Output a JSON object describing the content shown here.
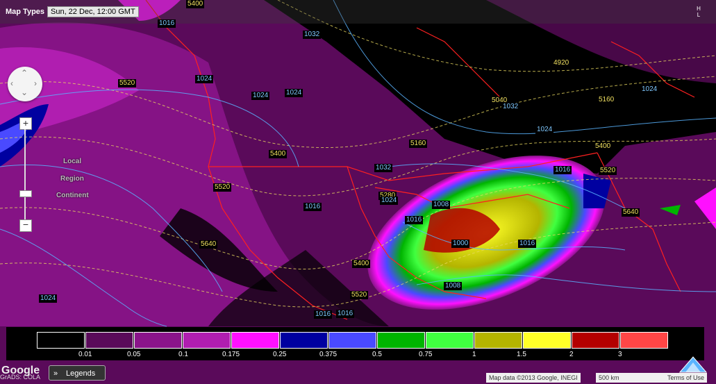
{
  "toolbar": {
    "map_types_label": "Map Types",
    "timestamp": "Sun, 22 Dec, 12:00 GMT",
    "hl_icon": "hl-icon"
  },
  "zoom": {
    "in_label": "+",
    "out_label": "−",
    "levels": [
      "Local",
      "Region",
      "Continent"
    ]
  },
  "contours": {
    "heights": [
      "5400",
      "5520",
      "4920",
      "5040",
      "5160",
      "5160",
      "5400",
      "5400",
      "5520",
      "5520",
      "5640",
      "5640",
      "5280",
      "5520",
      "5400"
    ],
    "pressure": [
      "1016",
      "1024",
      "1024",
      "1024",
      "1032",
      "1024",
      "1016",
      "1032",
      "1032",
      "1024",
      "1016",
      "1008",
      "1016",
      "1000",
      "1016",
      "1008",
      "1024",
      "1024",
      "1016",
      "1016"
    ]
  },
  "legend": {
    "colors": [
      "#000000",
      "#5a0a5a",
      "#8a148a",
      "#b01eb0",
      "#ff10ff",
      "#0000a0",
      "#4a4aff",
      "#00b400",
      "#40ff40",
      "#b4b400",
      "#ffff28",
      "#b40000",
      "#ff4646"
    ],
    "ticks": [
      "0.01",
      "0.05",
      "0.1",
      "0.175",
      "0.25",
      "0.375",
      "0.5",
      "0.75",
      "1",
      "1.5",
      "2",
      "3"
    ]
  },
  "footer": {
    "google": "Google",
    "grads": "GrADS: COLA",
    "legends_button": "Legends",
    "map_data": "Map data ©2013 Google, INEGI",
    "scale": "500 km",
    "terms": "Terms of Use"
  }
}
